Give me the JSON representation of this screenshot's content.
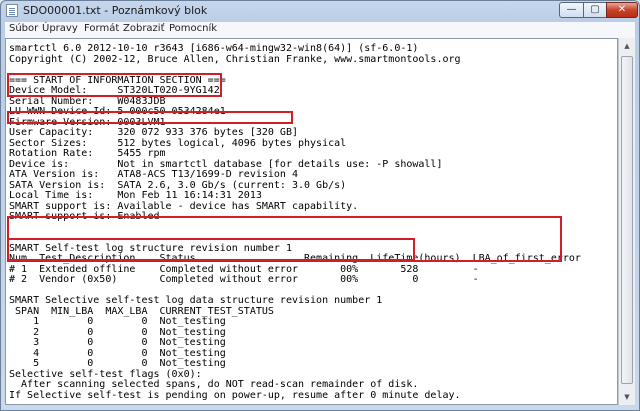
{
  "window": {
    "title": "SDO00001.txt - Poznámkový blok",
    "min_symbol": "—",
    "max_symbol": "▢",
    "close_symbol": "✕"
  },
  "menu": [
    "Súbor",
    "Úpravy",
    "Formát",
    "Zobraziť",
    "Pomocník"
  ],
  "lines": [
    "smartctl 6.0 2012-10-10 r3643 [i686-w64-mingw32-win8(64)] (sf-6.0-1)",
    "Copyright (C) 2002-12, Bruce Allen, Christian Franke, www.smartmontools.org",
    "",
    "=== START OF INFORMATION SECTION ===",
    "Device Model:     ST320LT020-9YG142",
    "Serial Number:    W0483JDB",
    "LU WWN Device Id: 5 000c50 0534284e1",
    "Firmware Version: 0003LVM1",
    "User Capacity:    320 072 933 376 bytes [320 GB]",
    "Sector Sizes:     512 bytes logical, 4096 bytes physical",
    "Rotation Rate:    5455 rpm",
    "Device is:        Not in smartctl database [for details use: -P showall]",
    "ATA Version is:   ATA8-ACS T13/1699-D revision 4",
    "SATA Version is:  SATA 2.6, 3.0 Gb/s (current: 3.0 Gb/s)",
    "Local Time is:    Mon Feb 11 16:14:31 2013",
    "SMART support is: Available - device has SMART capability.",
    "SMART support is: Enabled",
    "",
    "",
    "SMART Self-test log structure revision number 1",
    "Num  Test_Description    Status                  Remaining  LifeTime(hours)  LBA_of_first_error",
    "# 1  Extended offline    Completed without error       00%       528         -",
    "# 2  Vendor (0x50)       Completed without error       00%         0         -",
    "",
    "SMART Selective self-test log data structure revision number 1",
    " SPAN  MIN_LBA  MAX_LBA  CURRENT_TEST_STATUS",
    "    1        0        0  Not_testing",
    "    2        0        0  Not_testing",
    "    3        0        0  Not_testing",
    "    4        0        0  Not_testing",
    "    5        0        0  Not_testing",
    "Selective self-test flags (0x0):",
    "  After scanning selected spans, do NOT read-scan remainder of disk.",
    "If Selective self-test is pending on power-up, resume after 0 minute delay."
  ],
  "colors": {
    "highlight": "#d01f27"
  }
}
